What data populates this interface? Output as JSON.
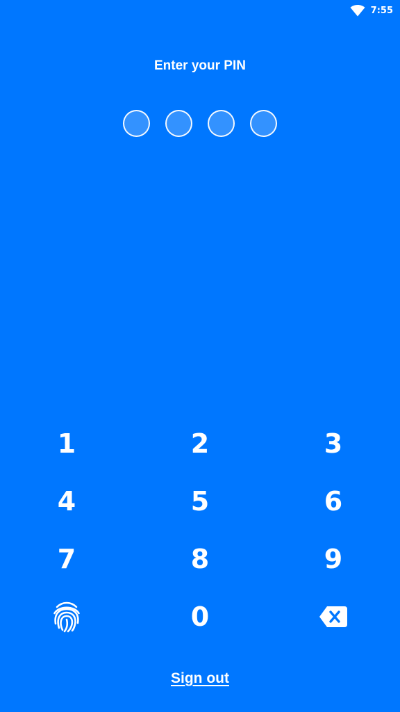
{
  "status_bar": {
    "time": "7:55",
    "wifi_icon": "wifi-icon"
  },
  "pin": {
    "title": "Enter your PIN",
    "dot_count": 4,
    "filled": 0
  },
  "keypad": {
    "keys": [
      "1",
      "2",
      "3",
      "4",
      "5",
      "6",
      "7",
      "8",
      "9"
    ],
    "zero": "0",
    "biometric_icon": "fingerprint-icon",
    "delete_icon": "backspace-icon"
  },
  "footer": {
    "sign_out_label": "Sign out"
  },
  "colors": {
    "background": "#0077FF",
    "foreground": "#FFFFFF"
  }
}
